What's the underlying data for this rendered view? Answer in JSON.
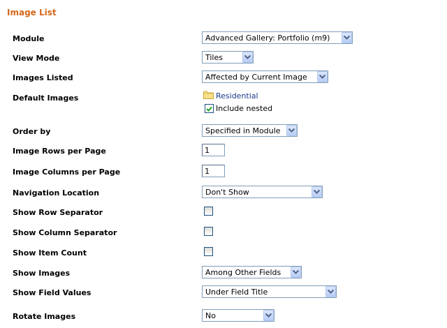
{
  "section_title": "Image List",
  "fields": {
    "module": {
      "label": "Module",
      "value": "Advanced Gallery: Portfolio (m9)"
    },
    "view_mode": {
      "label": "View Mode",
      "value": "Tiles"
    },
    "images_listed": {
      "label": "Images Listed",
      "value": "Affected by Current Image"
    },
    "default_images": {
      "label": "Default Images",
      "folder": "Residential",
      "include_nested_label": "Include nested",
      "include_nested_checked": true
    },
    "order_by": {
      "label": "Order by",
      "value": "Specified in Module"
    },
    "image_rows": {
      "label": "Image Rows per Page",
      "value": "1"
    },
    "image_columns": {
      "label": "Image Columns per Page",
      "value": "1"
    },
    "navigation_location": {
      "label": "Navigation Location",
      "value": "Don't Show"
    },
    "show_row_separator": {
      "label": "Show Row Separator",
      "checked": false
    },
    "show_column_separator": {
      "label": "Show Column Separator",
      "checked": false
    },
    "show_item_count": {
      "label": "Show Item Count",
      "checked": false
    },
    "show_images": {
      "label": "Show Images",
      "value": "Among Other Fields"
    },
    "show_field_values": {
      "label": "Show Field Values",
      "value": "Under Field Title"
    },
    "rotate_images": {
      "label": "Rotate Images",
      "value": "No"
    }
  },
  "colors": {
    "title": "#d2691e",
    "link": "#1a3a8a",
    "border": "#7f9db9"
  }
}
